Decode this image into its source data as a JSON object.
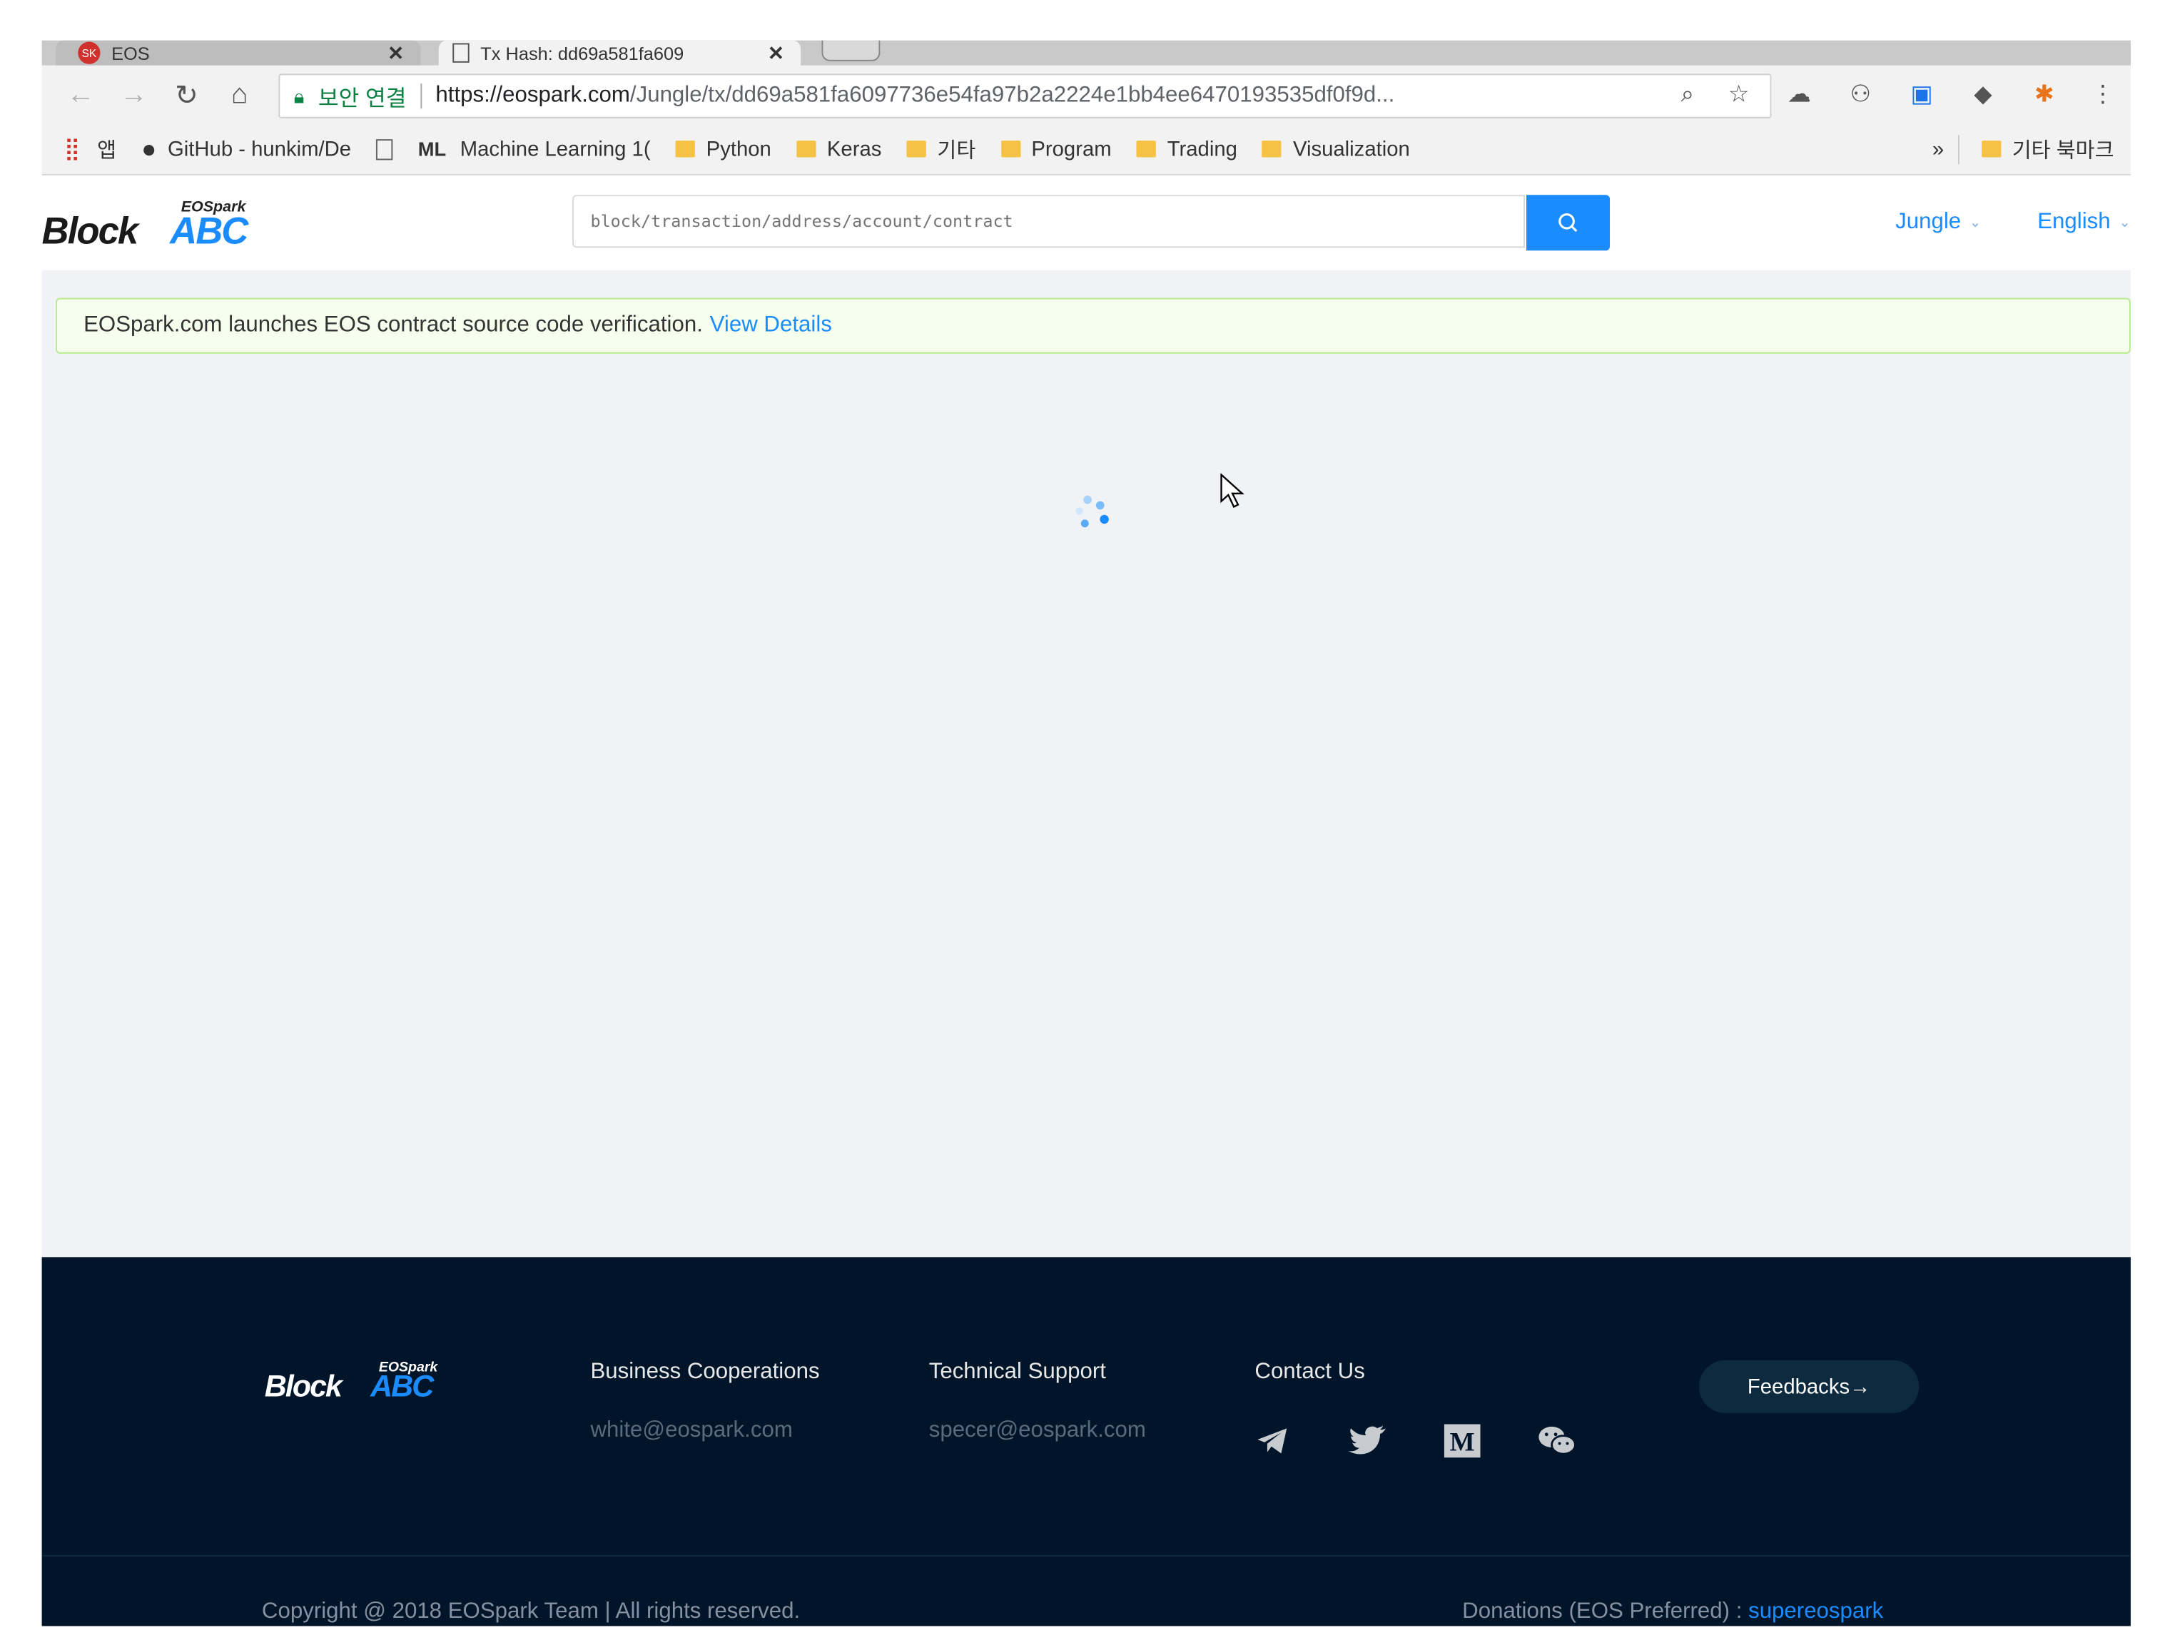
{
  "browser": {
    "tabs": [
      {
        "label": "EOS",
        "favicon_text": "SK"
      },
      {
        "label": "Tx Hash: dd69a581fa609"
      }
    ],
    "secure_label": "보안 연결",
    "url_domain": "https://eospark.com",
    "url_path": "/Jungle/tx/dd69a581fa6097736e54fa97b2a2224e1bb4ee6470193535df0f9d...",
    "bookmarks": [
      {
        "label": "앱",
        "icon": "apps-grid-icon"
      },
      {
        "label": "GitHub - hunkim/De",
        "icon": "github-icon"
      },
      {
        "label": "",
        "icon": "page-icon"
      },
      {
        "label": "Machine Learning 1(",
        "icon": "ml-icon"
      },
      {
        "label": "Python",
        "icon": "folder-icon"
      },
      {
        "label": "Keras",
        "icon": "folder-icon"
      },
      {
        "label": "기타",
        "icon": "folder-icon"
      },
      {
        "label": "Program",
        "icon": "folder-icon"
      },
      {
        "label": "Trading",
        "icon": "folder-icon"
      },
      {
        "label": "Visualization",
        "icon": "folder-icon"
      }
    ],
    "overflow_label": "»",
    "other_bookmarks": "기타 북마크",
    "colors": {
      "secure_green": "#0b8043",
      "folder": "#f6c244"
    }
  },
  "site": {
    "logo": {
      "small": "EOSpark",
      "block": "Block",
      "abc": "ABC"
    },
    "search": {
      "placeholder": "block/transaction/address/account/contract"
    },
    "network": "Jungle",
    "language": "English",
    "colors": {
      "accent": "#1a8cff",
      "footer_bg": "#001529",
      "notice_bg": "#f6ffed"
    }
  },
  "notice": {
    "text": "EOSpark.com launches EOS contract source code verification.",
    "link": "View Details"
  },
  "footer": {
    "logo": {
      "small": "EOSpark",
      "block": "Block",
      "abc": "ABC"
    },
    "business": {
      "heading": "Business Cooperations",
      "email": "white@eospark.com"
    },
    "tech": {
      "heading": "Technical Support",
      "email": "specer@eospark.com"
    },
    "contact": {
      "heading": "Contact Us"
    },
    "social": [
      "telegram-icon",
      "twitter-icon",
      "medium-icon",
      "wechat-icon"
    ],
    "feedback": "Feedbacks→",
    "copyright": "Copyright @ 2018 EOSpark Team | All rights reserved.",
    "donation_label": "Donations (EOS Preferred) : ",
    "donation_account": "supereospark"
  }
}
